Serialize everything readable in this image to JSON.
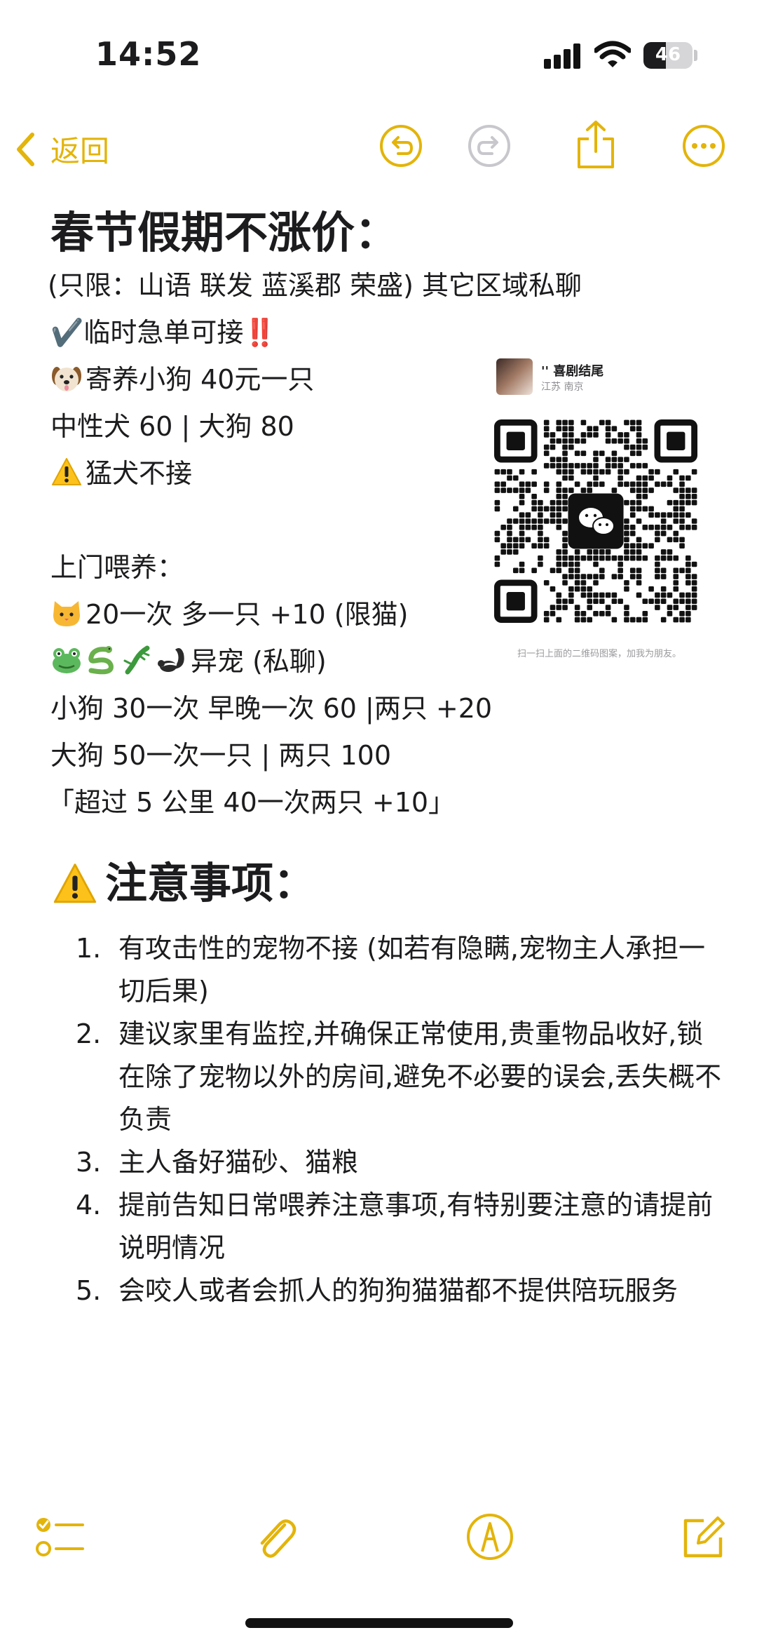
{
  "status": {
    "time": "14:52",
    "battery": "46",
    "battery_level": 0.46
  },
  "toolbar": {
    "back_label": "返回",
    "icons": [
      "undo-icon",
      "redo-icon",
      "share-icon",
      "more-icon"
    ]
  },
  "note": {
    "title": "春节假期不涨价：",
    "lines": {
      "l1": "(只限：山语 联发 蓝溪郡 荣盛) 其它区域私聊",
      "l2": "✔️临时急单可接‼️",
      "l3": "寄养小狗 40元一只",
      "l4": "中性犬 60 | 大狗 80",
      "l5": "猛犬不接",
      "l6": "上门喂养：",
      "l7": "20一次 多一只 +10 (限猫)",
      "l8": "异宠 (私聊)",
      "l9": "小狗 30一次 早晚一次 60  |两只 +20",
      "l10": "大狗 50一次一只 | 两只 100",
      "l11": "「超过 5 公里 40一次两只 +10」"
    },
    "notice_title": "注意事项：",
    "notices": [
      {
        "num": "1.",
        "text": "有攻击性的宠物不接 (如若有隐瞒,宠物主人承担一切后果)"
      },
      {
        "num": "2.",
        "text": "建议家里有监控,并确保正常使用,贵重物品收好,锁在除了宠物以外的房间,避免不必要的误会,丢失概不负责"
      },
      {
        "num": "3.",
        "text": "主人备好猫砂、猫粮"
      },
      {
        "num": "4.",
        "text": "提前告知日常喂养注意事项,有特别要注意的请提前说明情况"
      },
      {
        "num": "5.",
        "text": "会咬人或者会抓人的狗狗猫猫都不提供陪玩服务"
      }
    ]
  },
  "qr": {
    "name": "'' 喜剧结尾",
    "location": "江苏 南京",
    "caption": "扫一扫上面的二维码图案，加我为朋友。"
  },
  "bottom_bar": {
    "icons": [
      "checklist-icon",
      "attachment-icon",
      "markup-icon",
      "compose-icon"
    ]
  },
  "colors": {
    "accent": "#e3b40a",
    "text": "#1c1c1e"
  }
}
